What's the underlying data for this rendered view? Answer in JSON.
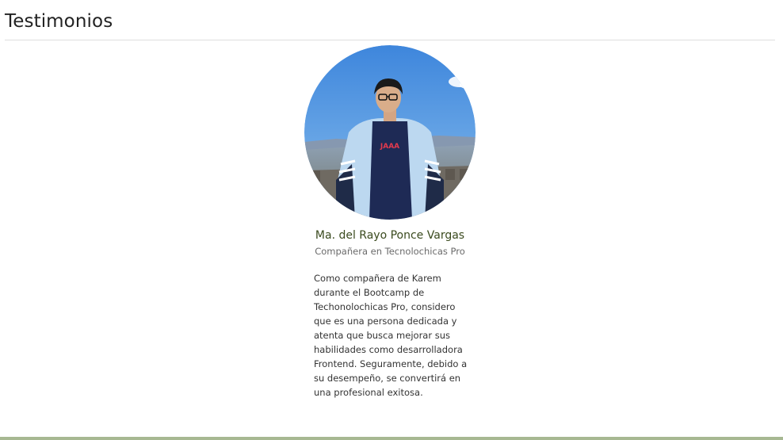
{
  "section": {
    "title": "Testimonios"
  },
  "testimonial": {
    "name": "Ma. del Rayo Ponce Vargas",
    "role": "Compañera en Tecnolochicas Pro",
    "quote": "Como compañera de Karem durante el Bootcamp de Techonolochicas Pro, considero que es una persona dedicada y atenta que busca mejorar sus habilidades como desarrolladora Frontend. Seguramente, debido a su desempeño, se convertirá en una profesional exitosa.",
    "photo": "avatar-photo"
  },
  "colors": {
    "name_text": "#3a4a1e",
    "footer_bar": "#a7b892",
    "divider": "#dedede"
  }
}
